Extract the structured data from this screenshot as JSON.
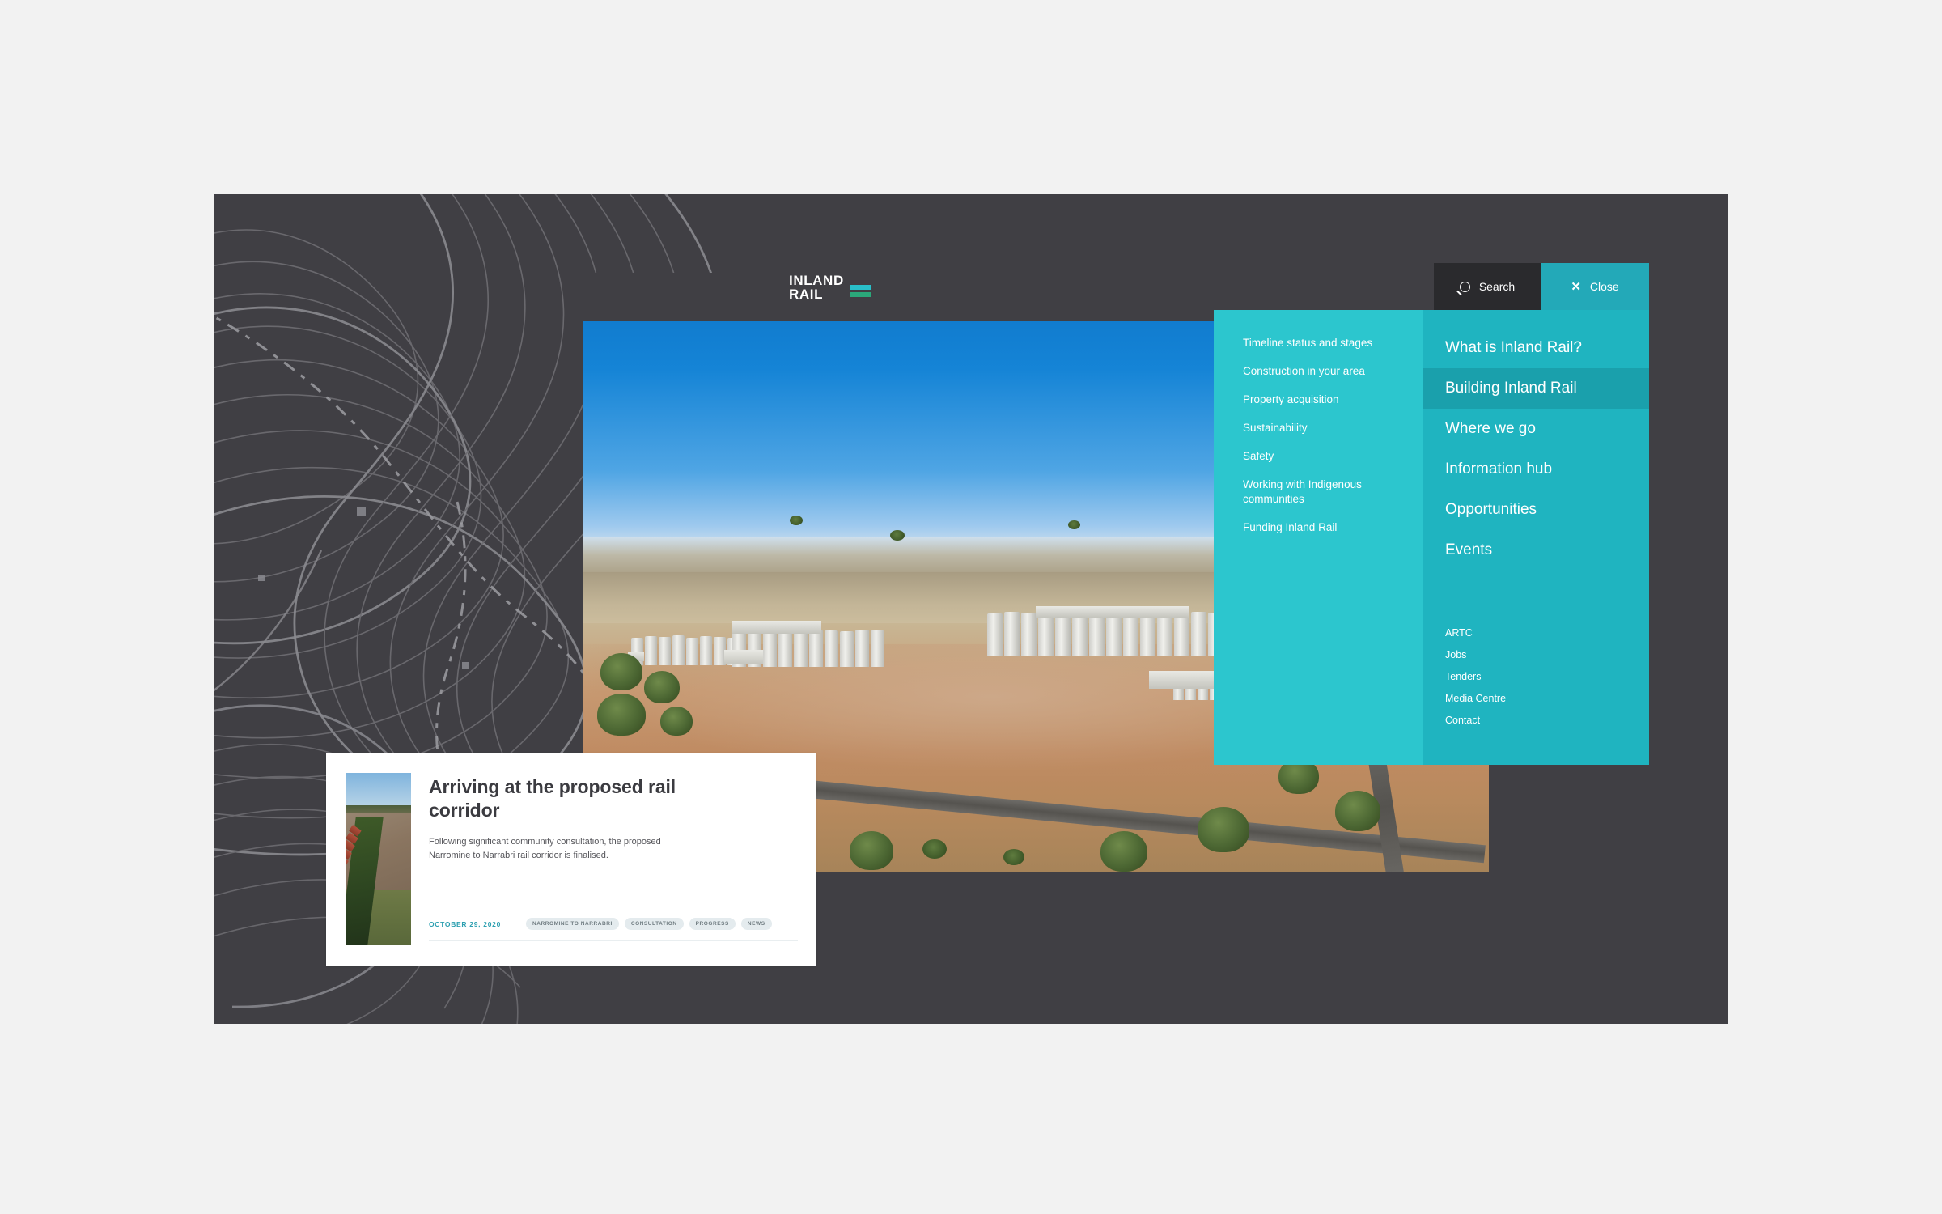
{
  "site": {
    "logo_line1": "INLAND",
    "logo_line2": "RAIL",
    "accent_teal": "#1FB4C0",
    "accent_teal_light": "#2CC6CE",
    "accent_teal_active": "#1AA0AC",
    "dark_bg": "#403F44",
    "page_bg": "#f2f2f2"
  },
  "header": {
    "search_label": "Search",
    "search_icon": "search-icon",
    "close_label": "Close",
    "close_icon": "close-icon"
  },
  "nav": {
    "submenu_title": "Building Inland Rail",
    "submenu_items": [
      {
        "label": "Timeline status and stages"
      },
      {
        "label": "Construction in your area"
      },
      {
        "label": "Property acquisition"
      },
      {
        "label": "Sustainability"
      },
      {
        "label": "Safety"
      },
      {
        "label": "Working with Indigenous communities"
      },
      {
        "label": "Funding Inland Rail"
      }
    ],
    "main_items": [
      {
        "label": "What is Inland Rail?",
        "active": false
      },
      {
        "label": "Building Inland Rail",
        "active": true
      },
      {
        "label": "Where we go",
        "active": false
      },
      {
        "label": "Information hub",
        "active": false
      },
      {
        "label": "Opportunities",
        "active": false
      },
      {
        "label": "Events",
        "active": false
      }
    ],
    "footer_links": [
      {
        "label": "ARTC"
      },
      {
        "label": "Jobs"
      },
      {
        "label": "Tenders"
      },
      {
        "label": "Media Centre"
      },
      {
        "label": "Contact"
      }
    ]
  },
  "hero": {
    "alt": "Aerial photograph of a rural grain silo facility beside a highway"
  },
  "card": {
    "thumb_alt": "Aerial view of a red freight train travelling beside a ploughed field",
    "title": "Arriving at the proposed rail corridor",
    "description": "Following significant community consultation, the proposed Narromine to Narrabri rail corridor is finalised.",
    "date": "OCTOBER 29, 2020",
    "tags": [
      {
        "label": "NARROMINE TO NARRABRI"
      },
      {
        "label": "CONSULTATION"
      },
      {
        "label": "PROGRESS"
      },
      {
        "label": "NEWS"
      }
    ]
  }
}
